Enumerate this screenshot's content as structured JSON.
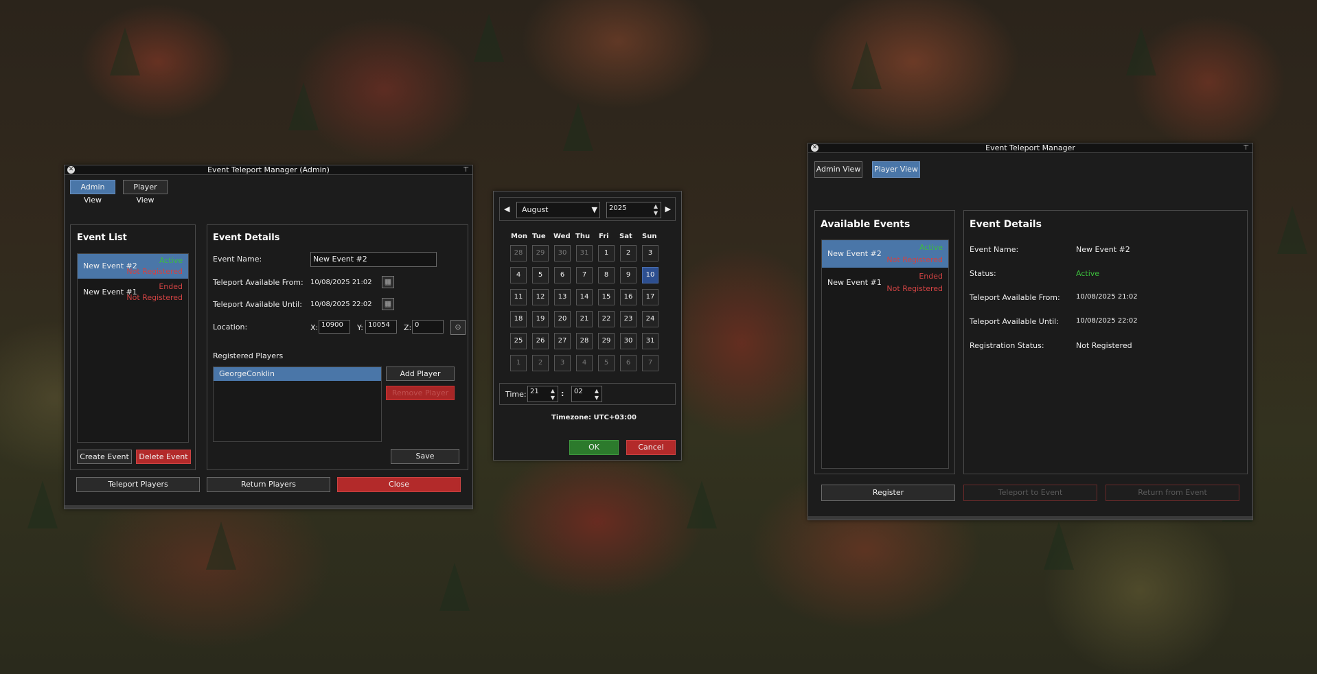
{
  "admin": {
    "title": "Event Teleport Manager (Admin)",
    "tabs": [
      "Admin View",
      "Player View"
    ],
    "event_list_title": "Event List",
    "events": [
      {
        "name": "New Event #2",
        "status": "Active",
        "reg": "Not Registered"
      },
      {
        "name": "New Event #1",
        "status": "Ended",
        "reg": "Not Registered"
      }
    ],
    "create_event": "Create Event",
    "delete_event": "Delete Event",
    "details_title": "Event Details",
    "event_name_label": "Event Name:",
    "event_name_value": "New Event #2",
    "from_label": "Teleport Available From:",
    "from_value": "10/08/2025 21:02",
    "until_label": "Teleport Available Until:",
    "until_value": "10/08/2025 22:02",
    "location_label": "Location:",
    "x_label": "X:",
    "x_value": "10900",
    "y_label": "Y:",
    "y_value": "10054",
    "z_label": "Z:",
    "z_value": "0",
    "registered_title": "Registered Players",
    "players": [
      "GeorgeConklin"
    ],
    "add_player": "Add Player",
    "remove_player": "Remove Player",
    "save": "Save",
    "teleport_players": "Teleport Players",
    "return_players": "Return Players",
    "close": "Close"
  },
  "calendar": {
    "month": "August",
    "year": "2025",
    "days_of_week": [
      "Mon",
      "Tue",
      "Wed",
      "Thu",
      "Fri",
      "Sat",
      "Sun"
    ],
    "days": [
      "28",
      "29",
      "30",
      "31",
      "1",
      "2",
      "3",
      "4",
      "5",
      "6",
      "7",
      "8",
      "9",
      "10",
      "11",
      "12",
      "13",
      "14",
      "15",
      "16",
      "17",
      "18",
      "19",
      "20",
      "21",
      "22",
      "23",
      "24",
      "25",
      "26",
      "27",
      "28",
      "29",
      "30",
      "31",
      "1",
      "2",
      "3",
      "4",
      "5",
      "6",
      "7"
    ],
    "time_label": "Time:",
    "hour": "21",
    "minute": "02",
    "separator": ":",
    "timezone": "Timezone: UTC+03:00",
    "ok": "OK",
    "cancel": "Cancel"
  },
  "player": {
    "title": "Event Teleport Manager",
    "tabs": [
      "Admin View",
      "Player View"
    ],
    "available_title": "Available Events",
    "events": [
      {
        "name": "New Event #2",
        "status": "Active",
        "reg": "Not Registered"
      },
      {
        "name": "New Event #1",
        "status": "Ended",
        "reg": "Not Registered"
      }
    ],
    "details_title": "Event Details",
    "rows": [
      {
        "label": "Event Name:",
        "value": "New Event #2"
      },
      {
        "label": "Status:",
        "value": "Active"
      },
      {
        "label": "Teleport Available From:",
        "value": "10/08/2025 21:02"
      },
      {
        "label": "Teleport Available Until:",
        "value": "10/08/2025 22:02"
      },
      {
        "label": "Registration Status:",
        "value": "Not Registered"
      }
    ],
    "register": "Register",
    "teleport_to_event": "Teleport to Event",
    "return_from_event": "Return from Event"
  },
  "colors": {
    "accent": "#4a76a8",
    "active": "#3cbf3c",
    "danger": "#d14343",
    "ok": "#2c7a2c"
  },
  "icons": {
    "close": "close-icon",
    "pin": "pin-icon",
    "calendar": "calendar-icon",
    "location": "location-pin-icon"
  }
}
